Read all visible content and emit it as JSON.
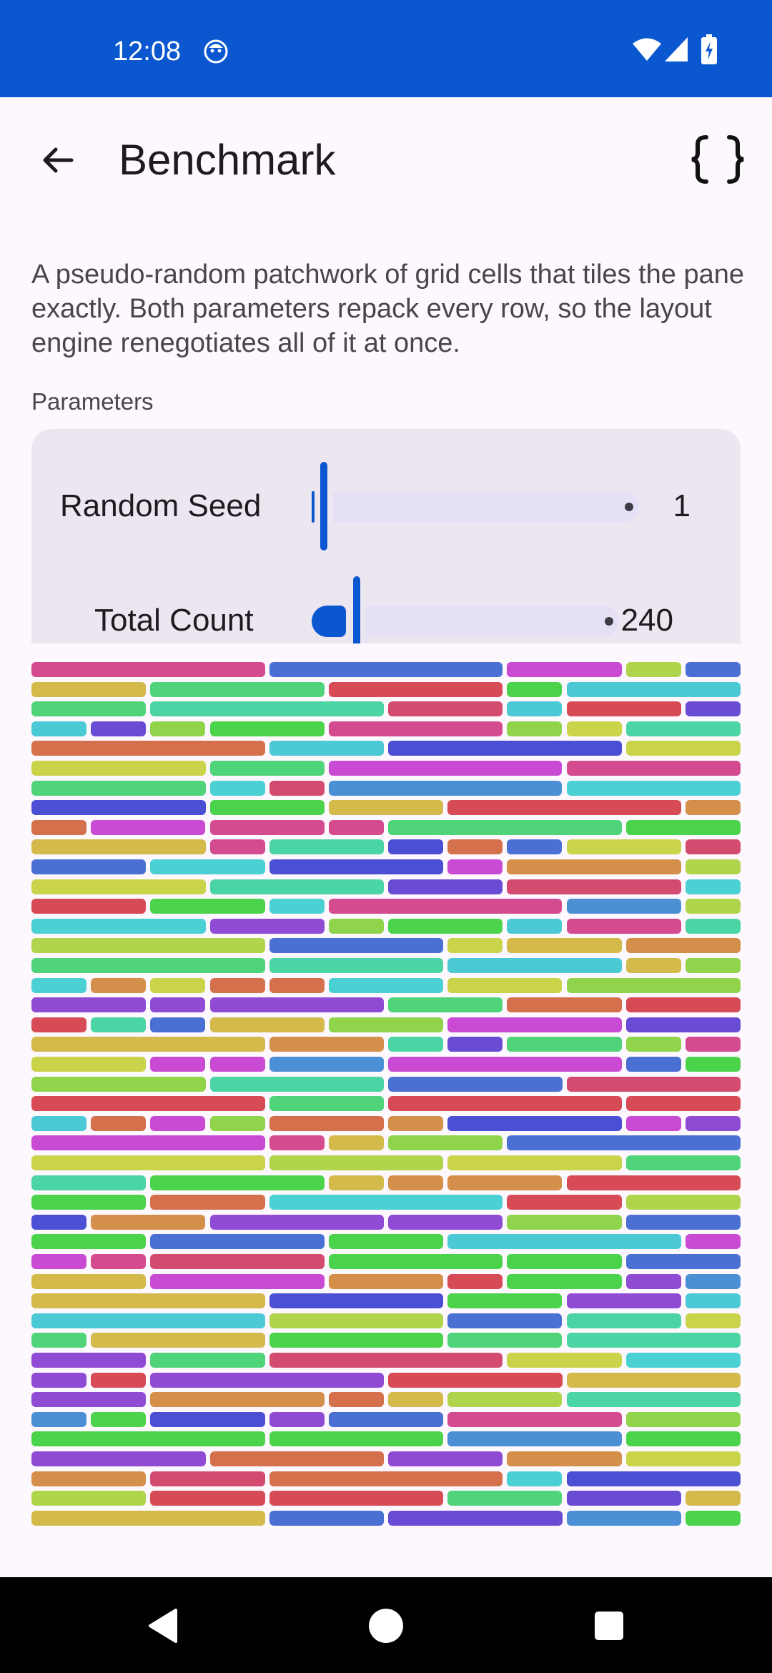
{
  "status_bar": {
    "time": "12:08",
    "icons": [
      "face-icon",
      "wifi-icon",
      "cellular-icon",
      "battery-charging-icon"
    ]
  },
  "app_bar": {
    "title": "Benchmark",
    "back_icon": "arrow-back-icon",
    "action_icon": "code-braces-icon"
  },
  "description": "A pseudo-random patchwork of grid cells that tiles the pane exactly. Both parameters repack every row, so the layout engine renegotiates all of it at once.",
  "parameters": {
    "section_label": "Parameters",
    "random_seed": {
      "label": "Random Seed",
      "value": "1"
    },
    "total_count": {
      "label": "Total Count",
      "value": "240"
    }
  },
  "colors": {
    "accent": "#0b57d0",
    "surface": "#fdf7fe",
    "card": "#ece6f0"
  },
  "patchwork": {
    "palette": [
      "#d64b55",
      "#4fd47a",
      "#8f4bd4",
      "#d4b94b",
      "#4bd0d4",
      "#d44b8f",
      "#8fd44b",
      "#4b4fd4",
      "#d4704b",
      "#4bd4a4",
      "#c94bd4",
      "#c9d44b",
      "#4b8fd4",
      "#4bd44b",
      "#6a4bd4",
      "#d4904b",
      "#4bc9d4",
      "#d44b70",
      "#b0d44b",
      "#4b70d4"
    ],
    "rows": 44,
    "total_count": 240
  },
  "nav_bar": {
    "icons": [
      "back-triangle-icon",
      "home-circle-icon",
      "recents-square-icon"
    ]
  }
}
